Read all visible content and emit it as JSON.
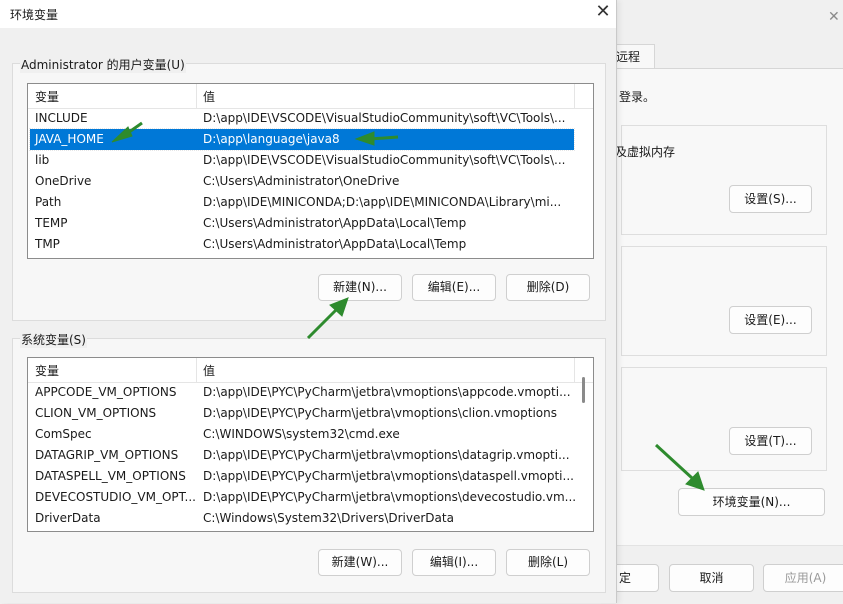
{
  "dialog": {
    "title": "环境变量",
    "user_group_label": "Administrator 的用户变量(U)",
    "system_group_label": "系统变量(S)",
    "columns": [
      "变量",
      "值"
    ],
    "user_vars": [
      {
        "name": "INCLUDE",
        "value": "D:\\app\\IDE\\VSCODE\\VisualStudioCommunity\\soft\\VC\\Tools\\..."
      },
      {
        "name": "JAVA_HOME",
        "value": "D:\\app\\language\\java8"
      },
      {
        "name": "lib",
        "value": "D:\\app\\IDE\\VSCODE\\VisualStudioCommunity\\soft\\VC\\Tools\\..."
      },
      {
        "name": "OneDrive",
        "value": "C:\\Users\\Administrator\\OneDrive"
      },
      {
        "name": "Path",
        "value": "D:\\app\\IDE\\MINICONDA;D:\\app\\IDE\\MINICONDA\\Library\\mi..."
      },
      {
        "name": "TEMP",
        "value": "C:\\Users\\Administrator\\AppData\\Local\\Temp"
      },
      {
        "name": "TMP",
        "value": "C:\\Users\\Administrator\\AppData\\Local\\Temp"
      }
    ],
    "user_selected_row": "JAVA_HOME",
    "user_buttons": {
      "new": "新建(N)...",
      "edit": "编辑(E)...",
      "delete": "删除(D)"
    },
    "system_vars": [
      {
        "name": "APPCODE_VM_OPTIONS",
        "value": "D:\\app\\IDE\\PYC\\PyCharm\\jetbra\\vmoptions\\appcode.vmopti..."
      },
      {
        "name": "CLION_VM_OPTIONS",
        "value": "D:\\app\\IDE\\PYC\\PyCharm\\jetbra\\vmoptions\\clion.vmoptions"
      },
      {
        "name": "ComSpec",
        "value": "C:\\WINDOWS\\system32\\cmd.exe"
      },
      {
        "name": "DATAGRIP_VM_OPTIONS",
        "value": "D:\\app\\IDE\\PYC\\PyCharm\\jetbra\\vmoptions\\datagrip.vmopti..."
      },
      {
        "name": "DATASPELL_VM_OPTIONS",
        "value": "D:\\app\\IDE\\PYC\\PyCharm\\jetbra\\vmoptions\\dataspell.vmopti..."
      },
      {
        "name": "DEVECOSTUDIO_VM_OPT...",
        "value": "D:\\app\\IDE\\PYC\\PyCharm\\jetbra\\vmoptions\\devecostudio.vm..."
      },
      {
        "name": "DriverData",
        "value": "C:\\Windows\\System32\\Drivers\\DriverData"
      }
    ],
    "system_buttons": {
      "new": "新建(W)...",
      "edit": "编辑(I)...",
      "delete": "删除(L)"
    }
  },
  "background_window": {
    "tab_label": "远程",
    "text_login": "登录。",
    "text_memory": "及虚拟内存",
    "settings_buttons": [
      "设置(S)...",
      "设置(E)...",
      "设置(T)..."
    ],
    "env_button": "环境变量(N)...",
    "footer_buttons": {
      "ok_partial": "定",
      "cancel": "取消",
      "apply": "应用(A)"
    }
  },
  "colors": {
    "selection": "#0078d7",
    "annotation_arrow": "#2e8b2e"
  }
}
